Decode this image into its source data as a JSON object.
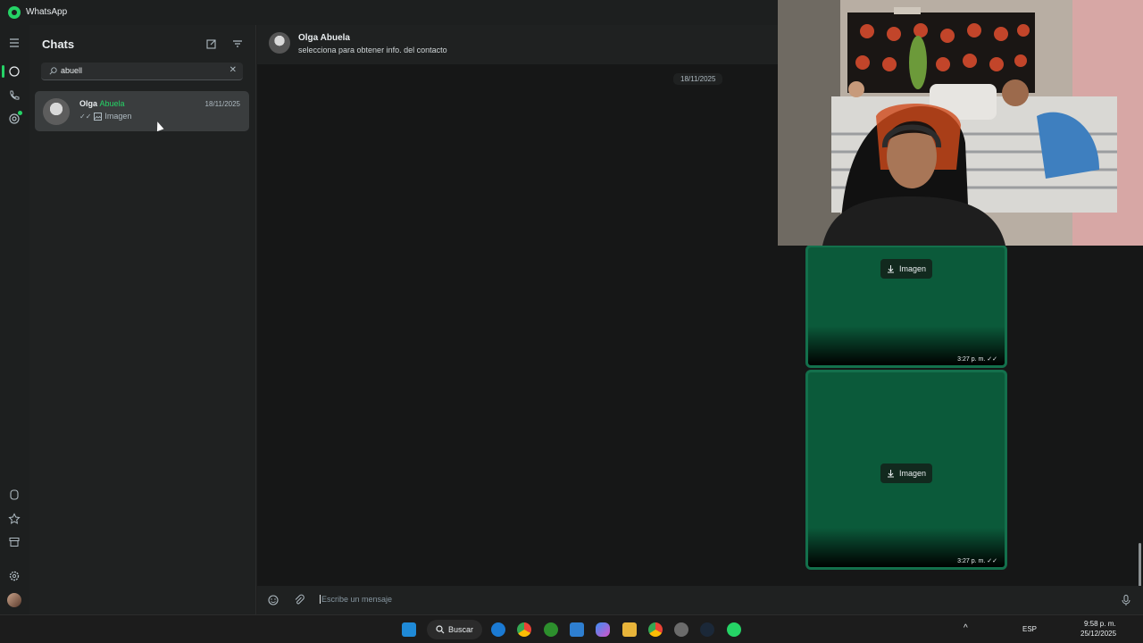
{
  "app": {
    "title": "WhatsApp"
  },
  "sidebar": {
    "title": "Chats",
    "icons": [
      "new-chat-icon",
      "filter-icon"
    ],
    "search": {
      "value": "abuell",
      "clear_icon": "close-icon"
    },
    "chats": [
      {
        "name_plain": "Olga",
        "name_highlight": "Abuela",
        "date": "18/11/2025",
        "preview": "Imagen",
        "status": "double-tick",
        "preview_icon": "image-icon"
      }
    ]
  },
  "rail": {
    "top_icons": [
      "menu-icon",
      "chats-icon",
      "calls-icon",
      "status-icon"
    ],
    "bottom_icons": [
      "channels-icon",
      "starred-icon",
      "archive-icon",
      "settings-icon",
      "profile-avatar"
    ]
  },
  "chat": {
    "contact_name": "Olga Abuela",
    "contact_subtitle": "selecciona para obtener info. del contacto",
    "date_chip": "18/11/2025",
    "messages": [
      {
        "type": "image",
        "download_label": "Imagen",
        "time": "3:27 p. m.",
        "status": "double-tick"
      },
      {
        "type": "image",
        "download_label": "Imagen",
        "time": "3:27 p. m.",
        "status": "double-tick"
      }
    ],
    "composer": {
      "placeholder": "Escribe un mensaje",
      "icons": [
        "emoji-icon",
        "attach-icon",
        "microphone-icon"
      ]
    }
  },
  "taskbar": {
    "search_label": "Buscar",
    "language": "ESP",
    "time": "9:58 p. m.",
    "date": "25/12/2025",
    "apps": [
      "windows-start",
      "search",
      "edge",
      "chrome",
      "xbox",
      "photos",
      "copilot",
      "file-explorer",
      "chrome-profile",
      "settings-app",
      "steam",
      "whatsapp"
    ]
  },
  "colors": {
    "accent": "#25d366",
    "image_bubble": "#0b5a3a",
    "sidebar_bg": "#1f2121",
    "chat_bg": "#161717"
  }
}
